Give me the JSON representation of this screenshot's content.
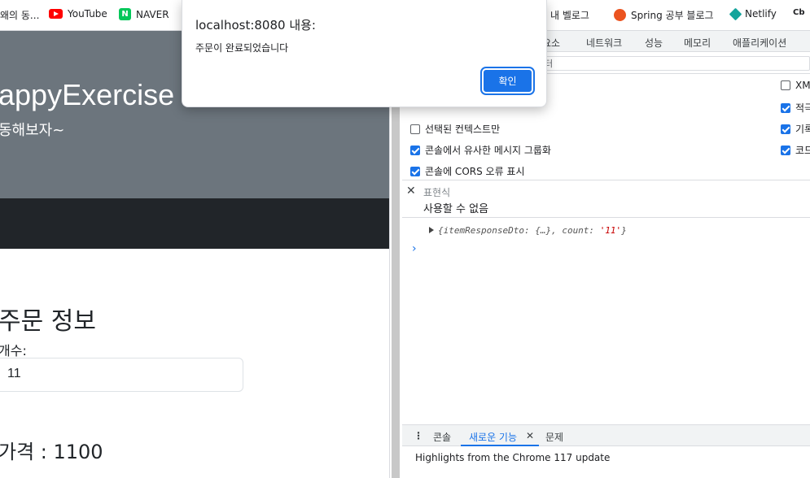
{
  "bookmarks": [
    {
      "label": "왜의 동...",
      "icon": "bookmark-folder-icon"
    },
    {
      "label": "YouTube",
      "icon": "youtube-icon",
      "color": "#ff0000"
    },
    {
      "label": "NAVER",
      "icon": "naver-icon",
      "color": "#03c75a"
    },
    {
      "label": "내 벨로그",
      "icon": "velog-icon",
      "color": "#20c997"
    },
    {
      "label": "Spring 공부 블로그",
      "icon": "tistory-icon",
      "color": "#eb531f"
    },
    {
      "label": "Netlify",
      "icon": "netlify-icon",
      "color": "#14a49c"
    },
    {
      "label": "Cb",
      "icon": "cb-icon"
    }
  ],
  "page": {
    "hero_title": "appyExercise",
    "hero_subtitle": "동해보자~",
    "order_title": "주문 정보",
    "quantity_label": "개수:",
    "quantity_value": "11",
    "price_text": "가격 : 1100"
  },
  "dialog": {
    "title": "localhost:8080 내용:",
    "message": "주문이 완료되었습니다",
    "ok_label": "확인"
  },
  "devtools": {
    "tabs": [
      "요소",
      "네트워크",
      "성능",
      "메모리",
      "애플리케이션"
    ],
    "filter_placeholder": "터",
    "settings_left": [
      {
        "label": "",
        "checked": false
      },
      {
        "label": "선택된 컨텍스트만",
        "checked": false
      },
      {
        "label": "콘솔에서 유사한 메시지 그룹화",
        "checked": true
      },
      {
        "label": "콘솔에 CORS 오류 표시",
        "checked": true
      }
    ],
    "settings_right": [
      {
        "label": "XM",
        "checked": false
      },
      {
        "label": "적극",
        "checked": true
      },
      {
        "label": "기록",
        "checked": true
      },
      {
        "label": "코드",
        "checked": true
      }
    ],
    "expression_label": "표현식",
    "expression_value": "사용할 수 없음",
    "log_prefix": "{itemResponseDto: {…}, count: ",
    "log_string": "'11'",
    "log_suffix": "}",
    "prompt_symbol": "›",
    "drawer_tabs": [
      "콘솔",
      "새로운 기능",
      "문제"
    ],
    "drawer_close": "✕",
    "drawer_more": "⋮",
    "drawer_message": "Highlights from the Chrome 117 update"
  },
  "colors": {
    "hero_bg": "#6c757d",
    "navbar_bg": "#212529",
    "accent": "#1a73e8"
  }
}
